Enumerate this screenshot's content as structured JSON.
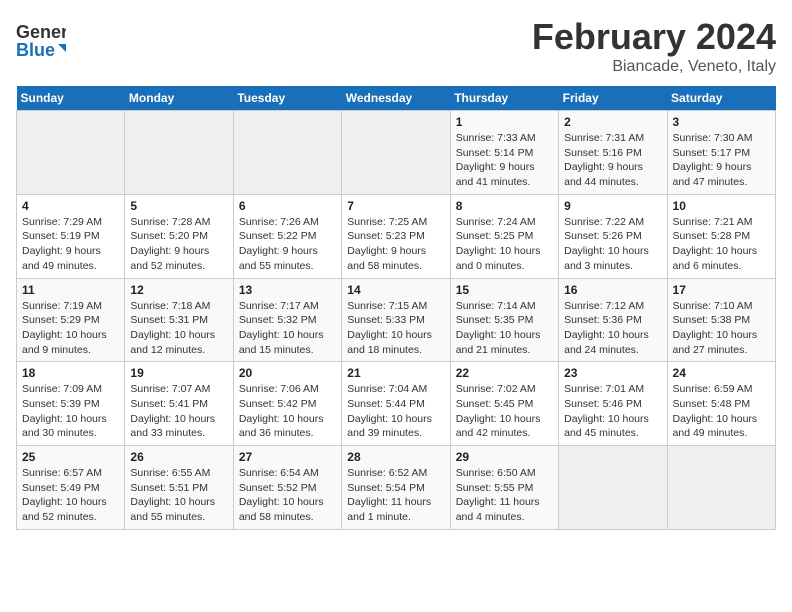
{
  "header": {
    "logo_line1": "General",
    "logo_line2": "Blue",
    "month_title": "February 2024",
    "subtitle": "Biancade, Veneto, Italy"
  },
  "days_of_week": [
    "Sunday",
    "Monday",
    "Tuesday",
    "Wednesday",
    "Thursday",
    "Friday",
    "Saturday"
  ],
  "weeks": [
    [
      {
        "day": "",
        "info": ""
      },
      {
        "day": "",
        "info": ""
      },
      {
        "day": "",
        "info": ""
      },
      {
        "day": "",
        "info": ""
      },
      {
        "day": "1",
        "info": "Sunrise: 7:33 AM\nSunset: 5:14 PM\nDaylight: 9 hours\nand 41 minutes."
      },
      {
        "day": "2",
        "info": "Sunrise: 7:31 AM\nSunset: 5:16 PM\nDaylight: 9 hours\nand 44 minutes."
      },
      {
        "day": "3",
        "info": "Sunrise: 7:30 AM\nSunset: 5:17 PM\nDaylight: 9 hours\nand 47 minutes."
      }
    ],
    [
      {
        "day": "4",
        "info": "Sunrise: 7:29 AM\nSunset: 5:19 PM\nDaylight: 9 hours\nand 49 minutes."
      },
      {
        "day": "5",
        "info": "Sunrise: 7:28 AM\nSunset: 5:20 PM\nDaylight: 9 hours\nand 52 minutes."
      },
      {
        "day": "6",
        "info": "Sunrise: 7:26 AM\nSunset: 5:22 PM\nDaylight: 9 hours\nand 55 minutes."
      },
      {
        "day": "7",
        "info": "Sunrise: 7:25 AM\nSunset: 5:23 PM\nDaylight: 9 hours\nand 58 minutes."
      },
      {
        "day": "8",
        "info": "Sunrise: 7:24 AM\nSunset: 5:25 PM\nDaylight: 10 hours\nand 0 minutes."
      },
      {
        "day": "9",
        "info": "Sunrise: 7:22 AM\nSunset: 5:26 PM\nDaylight: 10 hours\nand 3 minutes."
      },
      {
        "day": "10",
        "info": "Sunrise: 7:21 AM\nSunset: 5:28 PM\nDaylight: 10 hours\nand 6 minutes."
      }
    ],
    [
      {
        "day": "11",
        "info": "Sunrise: 7:19 AM\nSunset: 5:29 PM\nDaylight: 10 hours\nand 9 minutes."
      },
      {
        "day": "12",
        "info": "Sunrise: 7:18 AM\nSunset: 5:31 PM\nDaylight: 10 hours\nand 12 minutes."
      },
      {
        "day": "13",
        "info": "Sunrise: 7:17 AM\nSunset: 5:32 PM\nDaylight: 10 hours\nand 15 minutes."
      },
      {
        "day": "14",
        "info": "Sunrise: 7:15 AM\nSunset: 5:33 PM\nDaylight: 10 hours\nand 18 minutes."
      },
      {
        "day": "15",
        "info": "Sunrise: 7:14 AM\nSunset: 5:35 PM\nDaylight: 10 hours\nand 21 minutes."
      },
      {
        "day": "16",
        "info": "Sunrise: 7:12 AM\nSunset: 5:36 PM\nDaylight: 10 hours\nand 24 minutes."
      },
      {
        "day": "17",
        "info": "Sunrise: 7:10 AM\nSunset: 5:38 PM\nDaylight: 10 hours\nand 27 minutes."
      }
    ],
    [
      {
        "day": "18",
        "info": "Sunrise: 7:09 AM\nSunset: 5:39 PM\nDaylight: 10 hours\nand 30 minutes."
      },
      {
        "day": "19",
        "info": "Sunrise: 7:07 AM\nSunset: 5:41 PM\nDaylight: 10 hours\nand 33 minutes."
      },
      {
        "day": "20",
        "info": "Sunrise: 7:06 AM\nSunset: 5:42 PM\nDaylight: 10 hours\nand 36 minutes."
      },
      {
        "day": "21",
        "info": "Sunrise: 7:04 AM\nSunset: 5:44 PM\nDaylight: 10 hours\nand 39 minutes."
      },
      {
        "day": "22",
        "info": "Sunrise: 7:02 AM\nSunset: 5:45 PM\nDaylight: 10 hours\nand 42 minutes."
      },
      {
        "day": "23",
        "info": "Sunrise: 7:01 AM\nSunset: 5:46 PM\nDaylight: 10 hours\nand 45 minutes."
      },
      {
        "day": "24",
        "info": "Sunrise: 6:59 AM\nSunset: 5:48 PM\nDaylight: 10 hours\nand 49 minutes."
      }
    ],
    [
      {
        "day": "25",
        "info": "Sunrise: 6:57 AM\nSunset: 5:49 PM\nDaylight: 10 hours\nand 52 minutes."
      },
      {
        "day": "26",
        "info": "Sunrise: 6:55 AM\nSunset: 5:51 PM\nDaylight: 10 hours\nand 55 minutes."
      },
      {
        "day": "27",
        "info": "Sunrise: 6:54 AM\nSunset: 5:52 PM\nDaylight: 10 hours\nand 58 minutes."
      },
      {
        "day": "28",
        "info": "Sunrise: 6:52 AM\nSunset: 5:54 PM\nDaylight: 11 hours\nand 1 minute."
      },
      {
        "day": "29",
        "info": "Sunrise: 6:50 AM\nSunset: 5:55 PM\nDaylight: 11 hours\nand 4 minutes."
      },
      {
        "day": "",
        "info": ""
      },
      {
        "day": "",
        "info": ""
      }
    ]
  ]
}
